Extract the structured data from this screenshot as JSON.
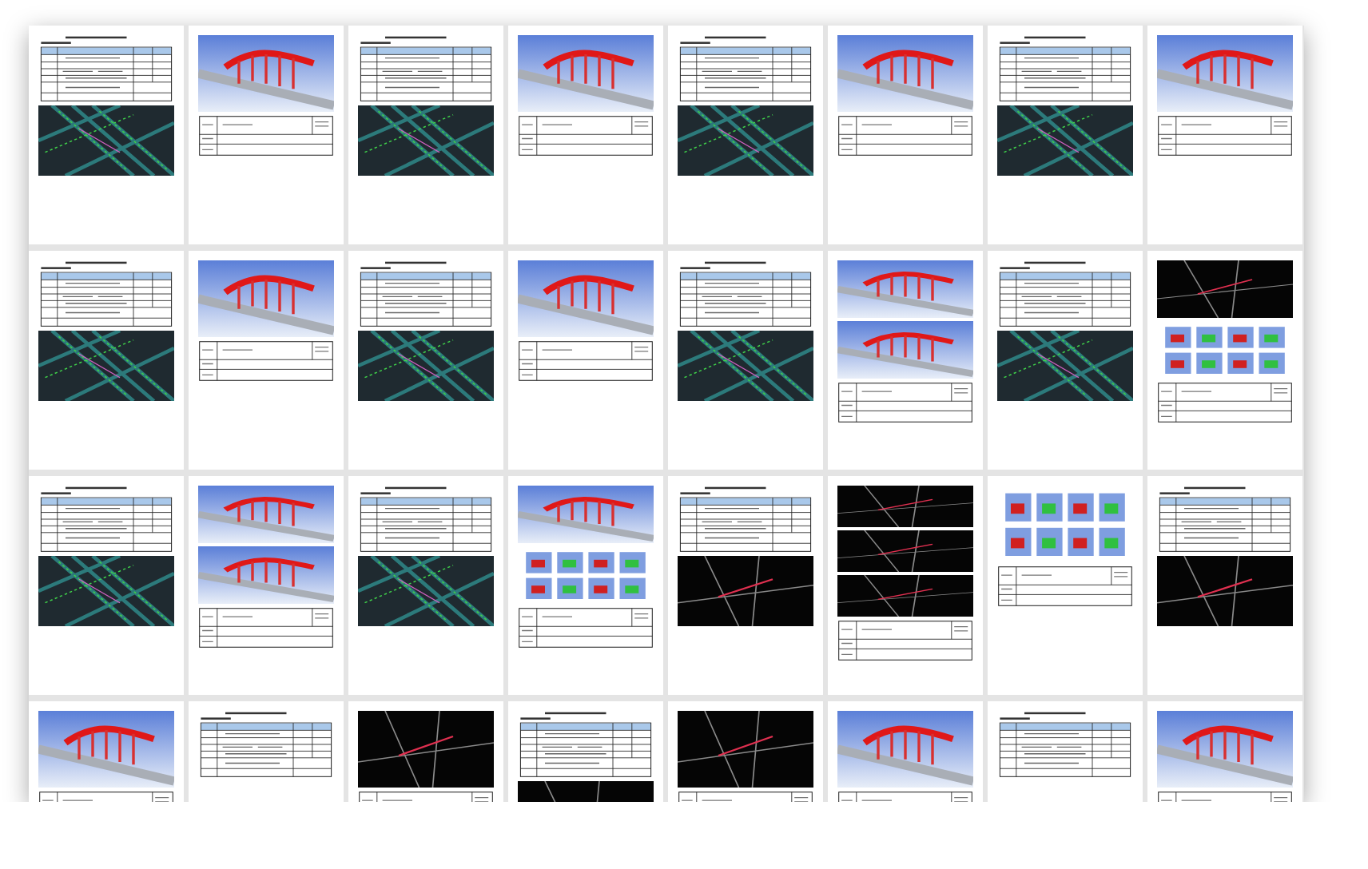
{
  "pages": [
    {
      "kind": "form",
      "images": [
        {
          "kind": "cad"
        }
      ]
    },
    {
      "kind": "figure",
      "images": [
        {
          "kind": "sky"
        }
      ]
    },
    {
      "kind": "form",
      "images": [
        {
          "kind": "cad"
        }
      ]
    },
    {
      "kind": "figure",
      "images": [
        {
          "kind": "sky"
        }
      ]
    },
    {
      "kind": "form",
      "images": [
        {
          "kind": "cad"
        }
      ]
    },
    {
      "kind": "figure",
      "images": [
        {
          "kind": "sky"
        }
      ]
    },
    {
      "kind": "form",
      "images": [
        {
          "kind": "cad"
        }
      ]
    },
    {
      "kind": "figure",
      "images": [
        {
          "kind": "sky"
        }
      ]
    },
    {
      "kind": "form",
      "images": [
        {
          "kind": "cad"
        }
      ]
    },
    {
      "kind": "figure",
      "images": [
        {
          "kind": "sky"
        }
      ]
    },
    {
      "kind": "form",
      "images": [
        {
          "kind": "cad"
        }
      ]
    },
    {
      "kind": "figure",
      "images": [
        {
          "kind": "sky"
        }
      ]
    },
    {
      "kind": "form",
      "images": [
        {
          "kind": "cad"
        }
      ]
    },
    {
      "kind": "figure",
      "images": [
        {
          "kind": "sky"
        },
        {
          "kind": "sky"
        }
      ]
    },
    {
      "kind": "form",
      "images": [
        {
          "kind": "cad"
        }
      ]
    },
    {
      "kind": "figure",
      "images": [
        {
          "kind": "dark"
        },
        {
          "kind": "tiles"
        }
      ]
    },
    {
      "kind": "form",
      "images": [
        {
          "kind": "cad"
        }
      ]
    },
    {
      "kind": "figure",
      "images": [
        {
          "kind": "sky"
        },
        {
          "kind": "sky"
        }
      ]
    },
    {
      "kind": "form",
      "images": [
        {
          "kind": "cad"
        }
      ]
    },
    {
      "kind": "figure",
      "images": [
        {
          "kind": "sky"
        },
        {
          "kind": "tiles"
        }
      ]
    },
    {
      "kind": "form",
      "images": [
        {
          "kind": "dark"
        }
      ]
    },
    {
      "kind": "figure",
      "images": [
        {
          "kind": "dark"
        },
        {
          "kind": "dark"
        },
        {
          "kind": "dark"
        }
      ]
    },
    {
      "kind": "figure",
      "images": [
        {
          "kind": "tiles"
        }
      ]
    },
    {
      "kind": "form",
      "images": [
        {
          "kind": "dark"
        }
      ]
    },
    {
      "kind": "figure",
      "images": [
        {
          "kind": "sky"
        }
      ]
    },
    {
      "kind": "form"
    },
    {
      "kind": "figure",
      "images": [
        {
          "kind": "dark"
        }
      ]
    },
    {
      "kind": "form",
      "images": [
        {
          "kind": "dark"
        }
      ]
    },
    {
      "kind": "figure",
      "images": [
        {
          "kind": "dark"
        }
      ]
    },
    {
      "kind": "figure",
      "images": [
        {
          "kind": "sky"
        }
      ]
    },
    {
      "kind": "form"
    },
    {
      "kind": "figure",
      "images": [
        {
          "kind": "sky"
        }
      ]
    }
  ]
}
